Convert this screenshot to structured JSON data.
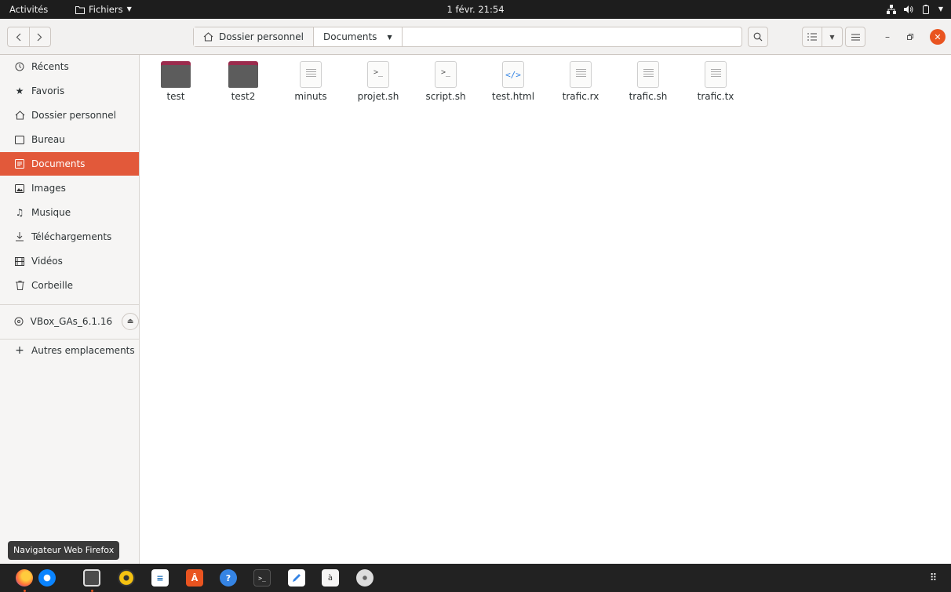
{
  "topbar": {
    "activities": "Activités",
    "app_name": "Fichiers",
    "clock": "1 févr. 21:54"
  },
  "nav": {
    "back_icon": "chevron-left-icon",
    "forward_icon": "chevron-right-icon"
  },
  "pathbar": {
    "home_label": "Dossier personnel",
    "current_label": "Documents"
  },
  "sidebar": {
    "items": [
      {
        "label": "Récents",
        "icon": "clock-icon"
      },
      {
        "label": "Favoris",
        "icon": "star-icon"
      },
      {
        "label": "Dossier personnel",
        "icon": "home-icon"
      },
      {
        "label": "Bureau",
        "icon": "desktop-icon"
      },
      {
        "label": "Documents",
        "icon": "document-icon",
        "active": true
      },
      {
        "label": "Images",
        "icon": "image-icon"
      },
      {
        "label": "Musique",
        "icon": "music-icon"
      },
      {
        "label": "Téléchargements",
        "icon": "download-icon"
      },
      {
        "label": "Vidéos",
        "icon": "video-icon"
      },
      {
        "label": "Corbeille",
        "icon": "trash-icon"
      }
    ],
    "device": {
      "label": "VBox_GAs_6.1.16",
      "icon": "disc-icon"
    },
    "other": {
      "label": "Autres emplacements",
      "icon": "plus-icon"
    }
  },
  "files": [
    {
      "name": "test",
      "kind": "folder"
    },
    {
      "name": "test2",
      "kind": "folder"
    },
    {
      "name": "minuts",
      "kind": "text"
    },
    {
      "name": "projet.sh",
      "kind": "script"
    },
    {
      "name": "script.sh",
      "kind": "script"
    },
    {
      "name": "test.html",
      "kind": "html"
    },
    {
      "name": "trafic.rx",
      "kind": "text"
    },
    {
      "name": "trafic.sh",
      "kind": "text"
    },
    {
      "name": "trafic.tx",
      "kind": "text"
    }
  ],
  "tooltip": "Navigateur Web Firefox",
  "dock": [
    "firefox-icon",
    "thunderbird-icon",
    "files-icon",
    "rhythmbox-icon",
    "writer-icon",
    "software-center-icon",
    "help-icon",
    "terminal-icon",
    "text-editor-icon",
    "character-map-icon",
    "disc-drive-icon"
  ],
  "colors": {
    "accent": "#e2593a",
    "folder_tab": "#9b2b4d",
    "folder_body": "#5c5c5c",
    "topbar": "#1d1d1d",
    "dock": "#222222"
  }
}
